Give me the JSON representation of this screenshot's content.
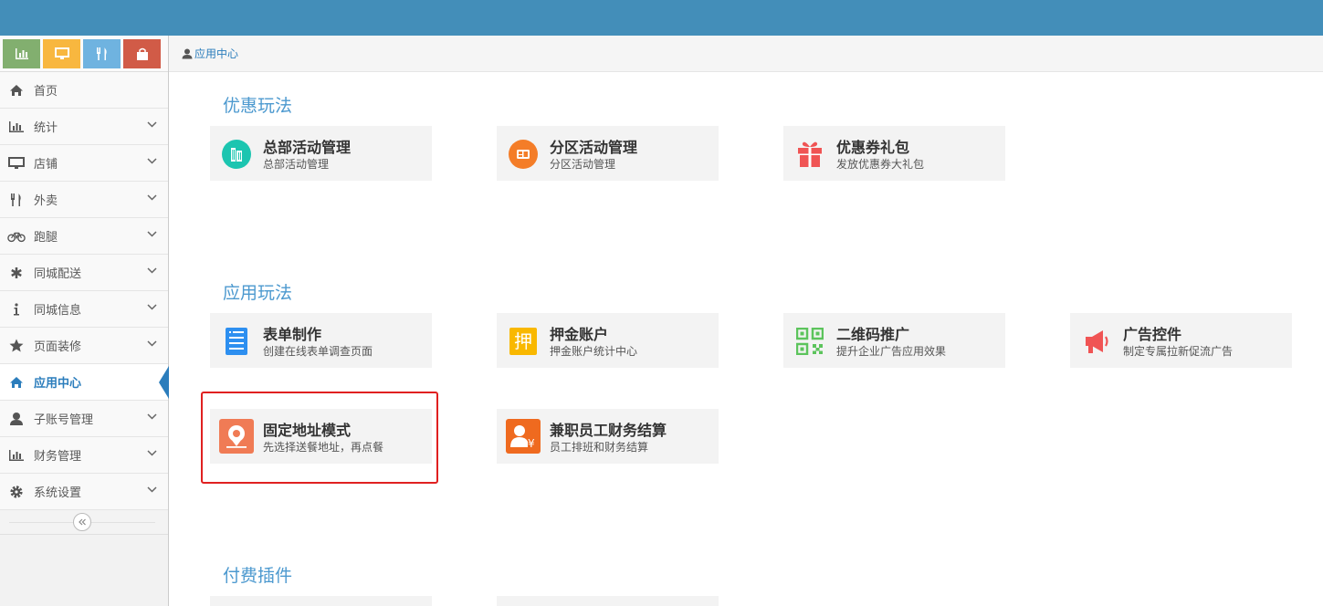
{
  "breadcrumb": {
    "label": "应用中心"
  },
  "sidebar": {
    "items": [
      {
        "label": "首页",
        "icon": "home-icon"
      },
      {
        "label": "统计",
        "icon": "bar-chart-icon"
      },
      {
        "label": "店铺",
        "icon": "monitor-icon"
      },
      {
        "label": "外卖",
        "icon": "fork-knife-icon"
      },
      {
        "label": "跑腿",
        "icon": "bicycle-icon"
      },
      {
        "label": "同城配送",
        "icon": "asterisk-icon"
      },
      {
        "label": "同城信息",
        "icon": "info-icon"
      },
      {
        "label": "页面装修",
        "icon": "star-icon"
      },
      {
        "label": "应用中心",
        "icon": "home-icon"
      },
      {
        "label": "子账号管理",
        "icon": "user-icon"
      },
      {
        "label": "财务管理",
        "icon": "bar-chart-icon"
      },
      {
        "label": "系统设置",
        "icon": "gear-icon"
      }
    ]
  },
  "sections": {
    "discount": "优惠玩法",
    "apps": "应用玩法",
    "paid": "付费插件"
  },
  "cards": {
    "hq_activity": {
      "title": "总部活动管理",
      "desc": "总部活动管理"
    },
    "zone_activity": {
      "title": "分区活动管理",
      "desc": "分区活动管理"
    },
    "coupon_pack": {
      "title": "优惠券礼包",
      "desc": "发放优惠券大礼包"
    },
    "form_maker": {
      "title": "表单制作",
      "desc": "创建在线表单调查页面"
    },
    "deposit": {
      "title": "押金账户",
      "desc": "押金账户统计中心",
      "icon_char": "押"
    },
    "qrcode": {
      "title": "二维码推广",
      "desc": "提升企业广告应用效果"
    },
    "ad_control": {
      "title": "广告控件",
      "desc": "制定专属拉新促流广告"
    },
    "fixed_address": {
      "title": "固定地址模式",
      "desc": "先选择送餐地址，再点餐"
    },
    "parttime": {
      "title": "兼职员工财务结算",
      "desc": "员工排班和财务结算",
      "icon_char": "¥"
    }
  },
  "colors": {
    "topbar": "#438eb9",
    "accent": "#2b7dbc",
    "section_title": "#4c99cf",
    "highlight": "#e02020"
  }
}
